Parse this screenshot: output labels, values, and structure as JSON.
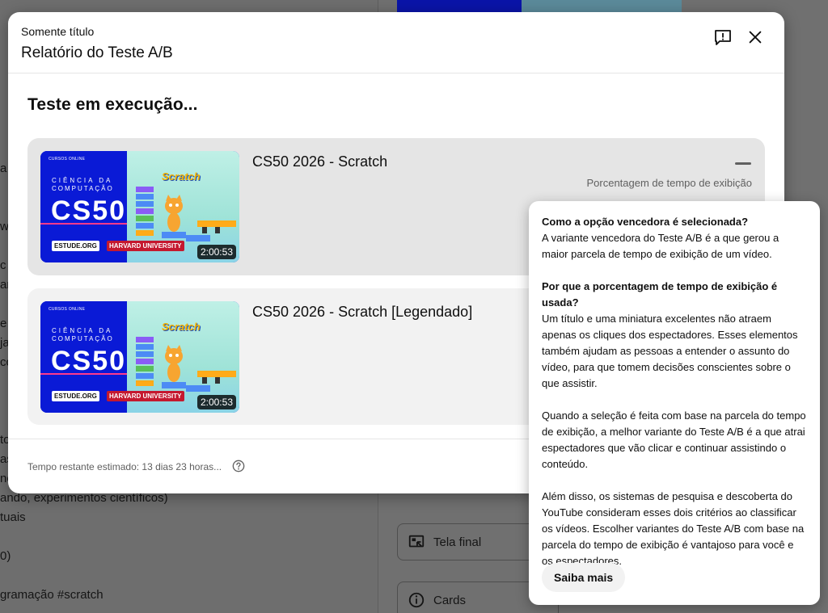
{
  "background": {
    "left_lines": [
      "a U",
      "w",
      "c",
      "an",
      "e c",
      "ja",
      "cc",
      "to",
      "as",
      "no",
      "ando, experimentos científicos)",
      "tuais",
      "0)",
      "gramação #scratch"
    ],
    "cards": [
      {
        "label": "Tela final",
        "icon": "end-screen-icon"
      },
      {
        "label": "Cards",
        "icon": "info-icon"
      }
    ]
  },
  "modal": {
    "subtitle": "Somente título",
    "title": "Relatório do Teste A/B",
    "section_title": "Teste em execução...",
    "metric_label": "Porcentagem de tempo de exibição",
    "variants": [
      {
        "title": "CS50 2026 - Scratch",
        "duration": "2:00:53",
        "thumb": {
          "brand": "CURSOS ONLINE",
          "line1": "CIÊNCIA DA",
          "line2": "COMPUTAÇÃO",
          "big": "CS50",
          "tag1": "ESTUDE.ORG",
          "tag2": "HARVARD UNIVERSITY",
          "scratch": "Scratch"
        }
      },
      {
        "title": "CS50 2026 - Scratch [Legendado]",
        "duration": "2:00:53",
        "thumb": {
          "brand": "CURSOS ONLINE",
          "line1": "CIÊNCIA DA",
          "line2": "COMPUTAÇÃO",
          "big": "CS50",
          "tag1": "ESTUDE.ORG",
          "tag2": "HARVARD UNIVERSITY",
          "scratch": "Scratch"
        }
      }
    ],
    "footer_text": "Tempo restante estimado: 13 dias 23 horas..."
  },
  "popover": {
    "q1": "Como a opção vencedora é selecionada?",
    "a1": "A variante vencedora do Teste A/B é a que gerou a maior parcela de tempo de exibição de um vídeo.",
    "q2": "Por que a porcentagem de tempo de exibição é usada?",
    "a2": "Um título e uma miniatura excelentes não atraem apenas os cliques dos espectadores. Esses elementos também ajudam as pessoas a entender o assunto do vídeo, para que tomem decisões conscientes sobre o que assistir.",
    "p3": "Quando a seleção é feita com base na parcela do tempo de exibição, a melhor variante do Teste A/B é a que atrai espectadores que vão clicar e continuar assistindo o conteúdo.",
    "p4": "Além disso, os sistemas de pesquisa e descoberta do YouTube consideram esses dois critérios ao classificar os vídeos. Escolher variantes do Teste A/B com base na parcela do tempo de exibição é vantajoso para você e os espectadores.",
    "button": "Saiba mais"
  }
}
